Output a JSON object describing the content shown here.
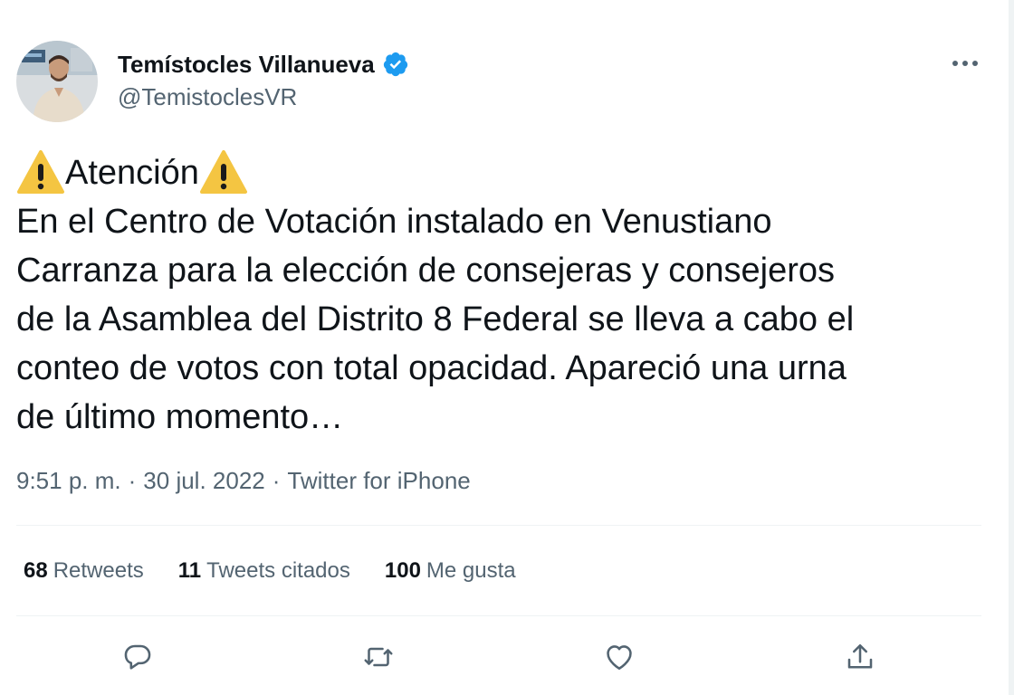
{
  "author": {
    "name": "Temístocles Villanueva",
    "handle": "@TemistoclesVR",
    "verified": true
  },
  "tweet": {
    "lines": [
      "Atención",
      "En el Centro de Votación instalado en Venustiano",
      "Carranza para la elección de consejeras y consejeros",
      "de la Asamblea del Distrito 8 Federal se lleva a cabo el",
      "conteo de votos con total opacidad. Apareció una urna",
      "de último momento…"
    ]
  },
  "meta": {
    "time": "9:51 p. m.",
    "separator": "·",
    "date": "30 jul. 2022",
    "source": "Twitter for iPhone"
  },
  "stats": {
    "retweets": {
      "count": "68",
      "label": "Retweets"
    },
    "quotes": {
      "count": "11",
      "label": "Tweets citados"
    },
    "likes": {
      "count": "100",
      "label": "Me gusta"
    }
  },
  "actions": {
    "reply": "reply-icon",
    "retweet": "retweet-icon",
    "like": "heart-icon",
    "share": "share-icon"
  },
  "colors": {
    "text": "#0f1419",
    "secondary": "#536471",
    "divider": "#eff3f4",
    "verified": "#1d9bf0",
    "warning": "#f4c542"
  }
}
